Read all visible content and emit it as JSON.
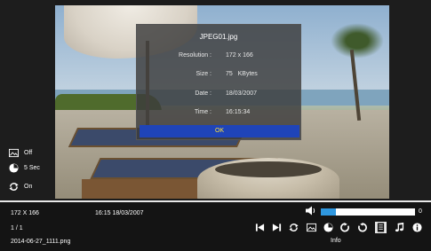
{
  "dialog": {
    "title": "JPEG01.jpg",
    "rows": [
      {
        "label": "Resolution :",
        "value": "172 x 166"
      },
      {
        "label": "Size :",
        "value": "75   KBytes"
      },
      {
        "label": "Date :",
        "value": "18/03/2007"
      },
      {
        "label": "Time :",
        "value": "16:15:34"
      }
    ],
    "ok_label": "OK"
  },
  "status": {
    "slideshow": {
      "icon": "picture-icon",
      "label": "Off"
    },
    "interval": {
      "icon": "clock-icon",
      "label": "5 Sec"
    },
    "repeat": {
      "icon": "repeat-icon",
      "label": "On"
    }
  },
  "footer": {
    "resolution": "172 X 166",
    "datetime": "16:15  18/03/2007",
    "position": "1 / 1",
    "filename": "2014-06-27_1111.png",
    "volume_value": "0",
    "volume_fraction": 0.16,
    "selected_control_label": "Info"
  },
  "controls": [
    {
      "icon": "skip-previous-icon"
    },
    {
      "icon": "skip-next-icon"
    },
    {
      "icon": "repeat-icon"
    },
    {
      "icon": "picture-icon"
    },
    {
      "icon": "clock-icon"
    },
    {
      "icon": "rotate-right-icon"
    },
    {
      "icon": "rotate-left-icon"
    },
    {
      "icon": "info-page-icon"
    },
    {
      "icon": "music-note-icon"
    },
    {
      "icon": "info-icon"
    }
  ],
  "colors": {
    "ok_button": "#1f44b8",
    "ok_text": "#ffe23a",
    "volume_fill": "#2f97df"
  }
}
